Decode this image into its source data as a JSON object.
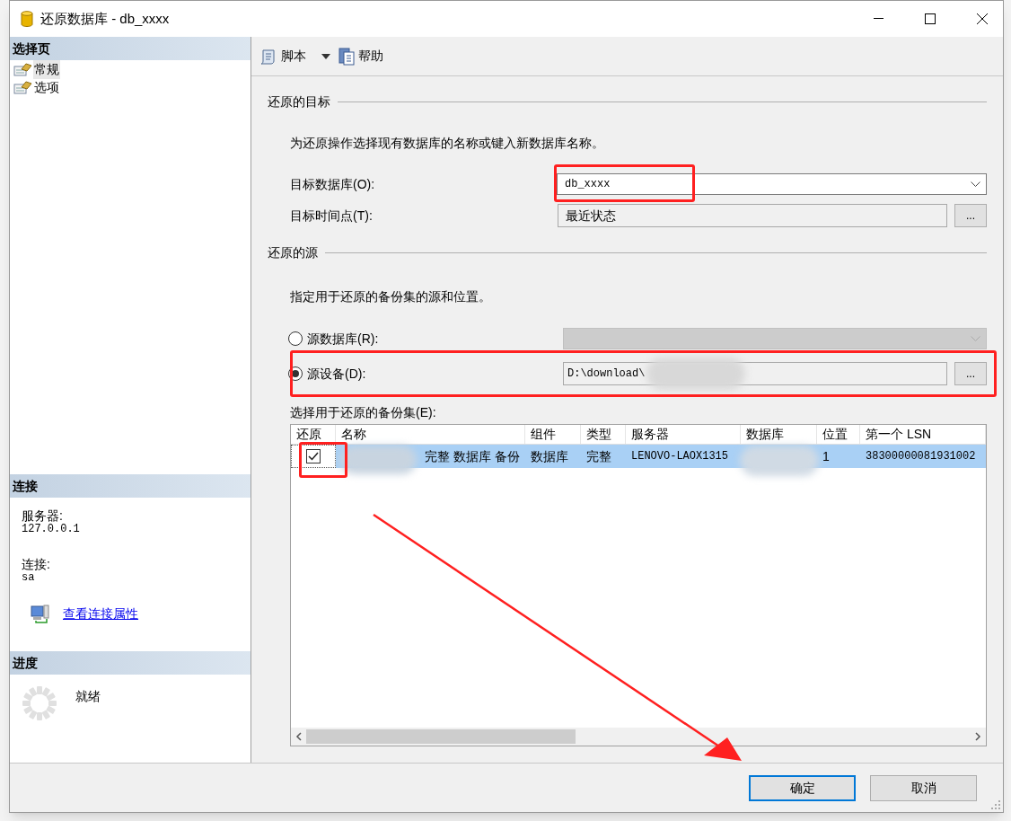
{
  "window": {
    "title": "还原数据库 - db_xxxx"
  },
  "sidebar": {
    "select_page": {
      "heading": "选择页",
      "items": [
        {
          "label": "常规",
          "selected": true
        },
        {
          "label": "选项",
          "selected": false
        }
      ]
    },
    "connection": {
      "heading": "连接",
      "server_label": "服务器:",
      "server": "127.0.0.1",
      "login_label": "连接:",
      "login": "sa",
      "link": "查看连接属性"
    },
    "progress": {
      "heading": "进度",
      "status": "就绪"
    }
  },
  "toolbar": [
    {
      "label": "脚本",
      "kind": "script"
    },
    {
      "label": "帮助",
      "kind": "help"
    }
  ],
  "destination": {
    "heading": "还原的目标",
    "hint": "为还原操作选择现有数据库的名称或键入新数据库名称。",
    "database_label": "目标数据库(O):",
    "database": "db_xxxx",
    "time_label": "目标时间点(T):",
    "time": "最近状态",
    "browse_button": "..."
  },
  "source": {
    "heading": "还原的源",
    "hint": "指定用于还原的备份集的源和位置。",
    "options": [
      {
        "label": "源数据库(R):",
        "selected": false,
        "kind": "dropdown"
      },
      {
        "label": "源设备(D):",
        "selected": true,
        "kind": "path",
        "value": "D:\\download\\",
        "browse_button": "..."
      }
    ]
  },
  "backup_sets": {
    "label": "选择用于还原的备份集(E):",
    "columns": [
      "还原",
      "名称",
      "组件",
      "类型",
      "服务器",
      "数据库",
      "位置",
      "第一个 LSN"
    ],
    "rows": [
      {
        "restore": true,
        "selected": true,
        "cells": [
          "",
          "完整 数据库 备份",
          "数据库",
          "完整",
          "LENOVO-LAOX1315",
          "",
          "1",
          "38300000081931002"
        ]
      }
    ]
  },
  "buttons": [
    {
      "label": "确定",
      "default": true
    },
    {
      "label": "取消",
      "default": false
    }
  ]
}
